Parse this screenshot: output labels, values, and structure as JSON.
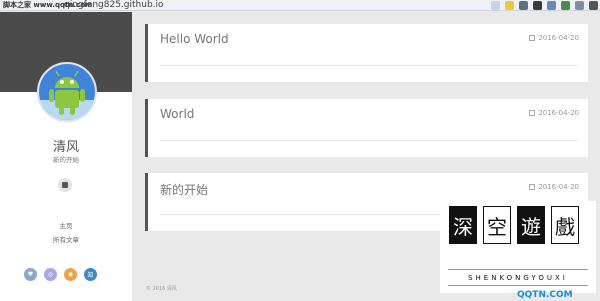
{
  "browser": {
    "tab_title": "脚本之家 www.qqtn.com",
    "url": "qingfeng825.github.io",
    "toolbar_icons": [
      "tab-icon",
      "star-icon",
      "shield-icon",
      "extension-icon",
      "extension-icon",
      "extension-icon",
      "mail-icon",
      "menu-icon"
    ]
  },
  "sidebar": {
    "avatar_label": "android-avatar",
    "site_name": "清风",
    "site_subtitle": "新的开始",
    "nav": [
      {
        "label": "主页"
      },
      {
        "label": "所有文章"
      }
    ],
    "socials": [
      {
        "name": "weibo-icon",
        "glyph": "♥",
        "color": "#8fa6c9"
      },
      {
        "name": "douban-icon",
        "glyph": "◎",
        "color": "#a7a7e6"
      },
      {
        "name": "rss-icon",
        "glyph": "◉",
        "color": "#e9a54e"
      },
      {
        "name": "zhihu-icon",
        "glyph": "知",
        "color": "#3e88c7"
      }
    ]
  },
  "posts": [
    {
      "title": "Hello World",
      "date": "2016-04-20"
    },
    {
      "title": "World",
      "date": "2016-04-20"
    },
    {
      "title": "新的开始",
      "date": "2016-04-20"
    }
  ],
  "footer": {
    "text": "© 2016 清风"
  },
  "watermark": {
    "glyphs": [
      "深",
      "空",
      "遊",
      "戲"
    ],
    "latin": "SHENKONGYOUXI",
    "badge": "QQTN.COM"
  }
}
